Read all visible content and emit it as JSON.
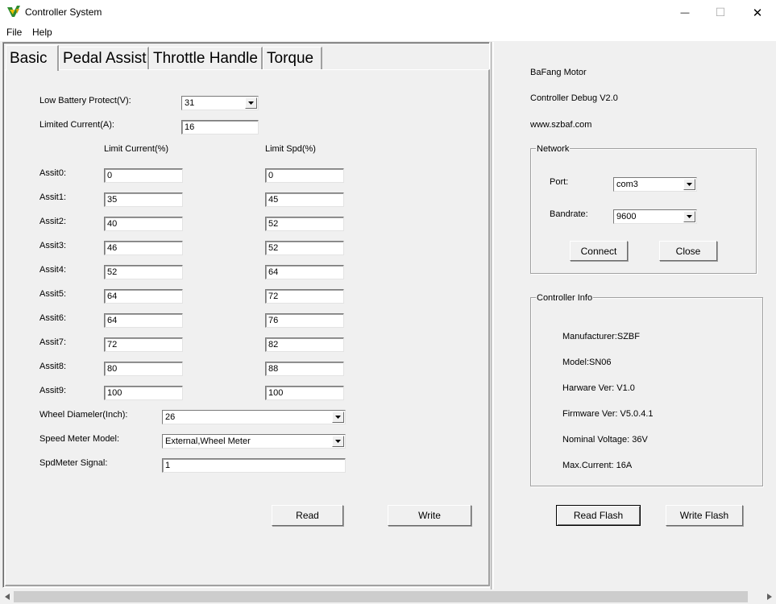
{
  "window": {
    "title": "Controller System",
    "minimize": "—",
    "maximize": "☐",
    "close": "✕"
  },
  "menu": [
    "File",
    "Help"
  ],
  "tabs": [
    "Basic",
    "Pedal Assist",
    "Throttle Handle",
    "Torque"
  ],
  "basic": {
    "low_battery_label": "Low Battery Protect(V):",
    "low_battery_value": "31",
    "limited_current_label": "Limited Current(A):",
    "limited_current_value": "16",
    "col_limit_current": "Limit Current(%)",
    "col_limit_spd": "Limit Spd(%)",
    "assists": [
      {
        "label": "Assit0:",
        "current": "0",
        "spd": "0"
      },
      {
        "label": "Assit1:",
        "current": "35",
        "spd": "45"
      },
      {
        "label": "Assit2:",
        "current": "40",
        "spd": "52"
      },
      {
        "label": "Assit3:",
        "current": "46",
        "spd": "52"
      },
      {
        "label": "Assit4:",
        "current": "52",
        "spd": "64"
      },
      {
        "label": "Assit5:",
        "current": "64",
        "spd": "72"
      },
      {
        "label": "Assit6:",
        "current": "64",
        "spd": "76"
      },
      {
        "label": "Assit7:",
        "current": "72",
        "spd": "82"
      },
      {
        "label": "Assit8:",
        "current": "80",
        "spd": "88"
      },
      {
        "label": "Assit9:",
        "current": "100",
        "spd": "100"
      }
    ],
    "wheel_label": "Wheel Diameler(Inch):",
    "wheel_value": "26",
    "speed_meter_label": "Speed Meter Model:",
    "speed_meter_value": "External,Wheel Meter",
    "spdmeter_signal_label": "SpdMeter Signal:",
    "spdmeter_signal_value": "1",
    "read_button": "Read",
    "write_button": "Write"
  },
  "info": {
    "line1": "BaFang Motor",
    "line2": "Controller Debug V2.0",
    "line3": "www.szbaf.com"
  },
  "network": {
    "title": "Network",
    "port_label": "Port:",
    "port_value": "com3",
    "baud_label": "Bandrate:",
    "baud_value": "9600",
    "connect_button": "Connect",
    "close_button": "Close"
  },
  "controller_info": {
    "title": "Controller Info",
    "manufacturer": "Manufacturer:SZBF",
    "model": "Model:SN06",
    "hardware": "Harware Ver: V1.0",
    "firmware": "Firmware Ver: V5.0.4.1",
    "voltage": "Nominal Voltage: 36V",
    "current": "Max.Current: 16A"
  },
  "read_flash_button": "Read Flash",
  "write_flash_button": "Write Flash"
}
